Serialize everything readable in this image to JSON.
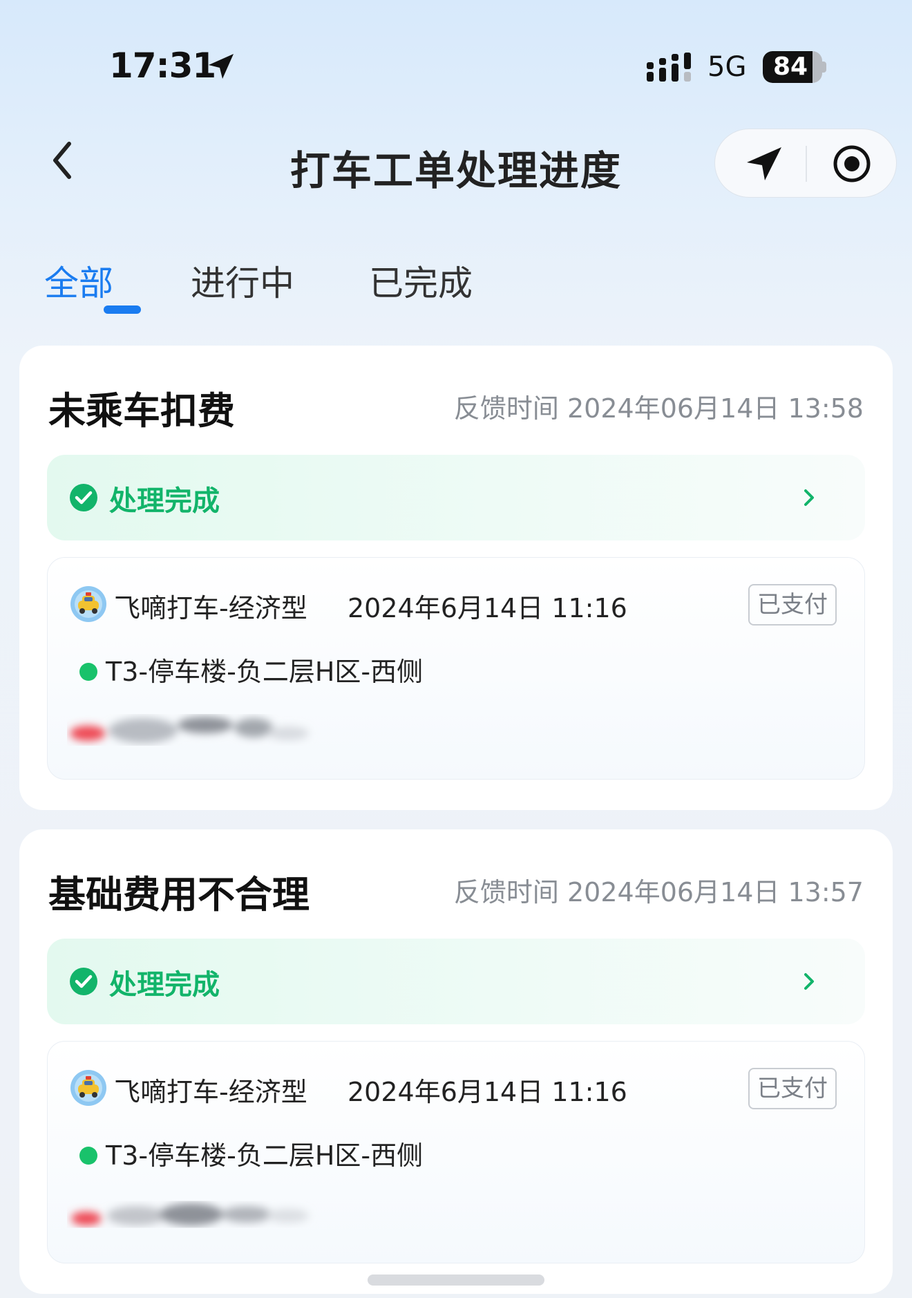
{
  "status_bar": {
    "time": "17:31",
    "network": "5G",
    "battery_percent": "84",
    "battery_level": 0.84
  },
  "nav": {
    "title": "打车工单处理进度",
    "back_icon": "chevron-left-icon",
    "capsule_icons": [
      "navigation-arrow-icon",
      "record-circle-icon"
    ]
  },
  "tabs": [
    {
      "label": "全部",
      "active": true
    },
    {
      "label": "进行中",
      "active": false
    },
    {
      "label": "已完成",
      "active": false
    }
  ],
  "tickets": [
    {
      "title": "未乘车扣费",
      "feedback_time": "反馈时间 2024年06月14日 13:58",
      "status": "处理完成",
      "order": {
        "service": "飞嘀打车-经济型",
        "time": "2024年6月14日 11:16",
        "pay_status": "已支付",
        "pickup": "T3-停车楼-负二层H区-西侧"
      }
    },
    {
      "title": "基础费用不合理",
      "feedback_time": "反馈时间 2024年06月14日 13:57",
      "status": "处理完成",
      "order": {
        "service": "飞嘀打车-经济型",
        "time": "2024年6月14日 11:16",
        "pay_status": "已支付",
        "pickup": "T3-停车楼-负二层H区-西侧"
      }
    }
  ],
  "colors": {
    "accent": "#1a7cf0",
    "success": "#12b46a",
    "dot": "#19c26b"
  }
}
